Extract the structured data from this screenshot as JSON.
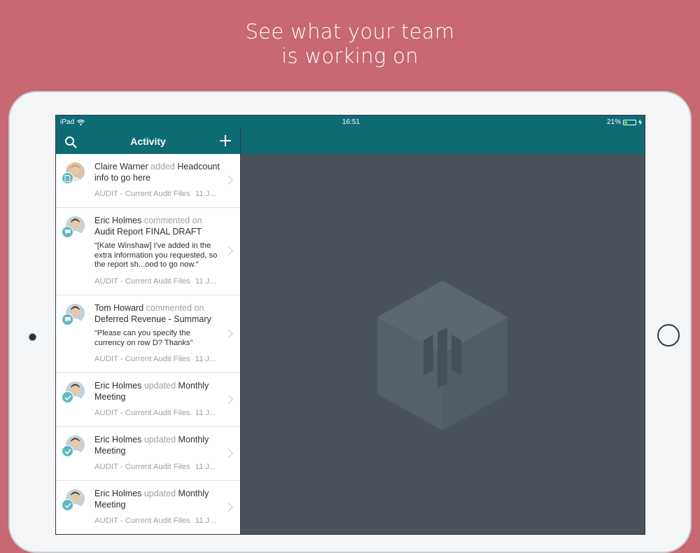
{
  "headline": {
    "line1": "See what your team",
    "line2": "is working on"
  },
  "statusbar": {
    "device": "iPad",
    "time": "16:51",
    "battery": "21%",
    "battery_level": 0.21
  },
  "sidebar": {
    "title": "Activity"
  },
  "feed": [
    {
      "actor": "Claire Warner",
      "verb": "added",
      "object": "Headcount info to go here",
      "quote": "",
      "meta": "AUDIT - Current Audit Files",
      "date": "11 J...",
      "badge": "document-icon"
    },
    {
      "actor": "Eric Holmes",
      "verb": "commented on",
      "object": "Audit Report FINAL DRAFT",
      "quote": "“[Kate Winshaw] I've added in the extra information you requested, so the report sh...ood to go now.”",
      "meta": "AUDIT - Current Audit Files",
      "date": "11 J...",
      "badge": "comment-icon"
    },
    {
      "actor": "Tom Howard",
      "verb": "commented on",
      "object": "Deferred Revenue - Summary",
      "quote": "“Please can you specify the currency on row D? Thanks”",
      "meta": "AUDIT - Current Audit Files",
      "date": "11 J...",
      "badge": "comment-icon"
    },
    {
      "actor": "Eric Holmes",
      "verb": "updated",
      "object": "Monthly Meeting",
      "quote": "",
      "meta": "AUDIT - Current Audit Files",
      "date": "11 J...",
      "badge": "check-icon"
    },
    {
      "actor": "Eric Holmes",
      "verb": "updated",
      "object": "Monthly Meeting",
      "quote": "",
      "meta": "AUDIT - Current Audit Files",
      "date": "11 J...",
      "badge": "check-icon"
    },
    {
      "actor": "Eric Holmes",
      "verb": "updated",
      "object": "Monthly Meeting",
      "quote": "",
      "meta": "AUDIT - Current Audit Files",
      "date": "11 J...",
      "badge": "check-icon"
    }
  ],
  "colors": {
    "background": "#c76872",
    "brand_teal": "#0e6b73",
    "detail_pane": "#4a535b",
    "badge": "#5fb8c0"
  }
}
